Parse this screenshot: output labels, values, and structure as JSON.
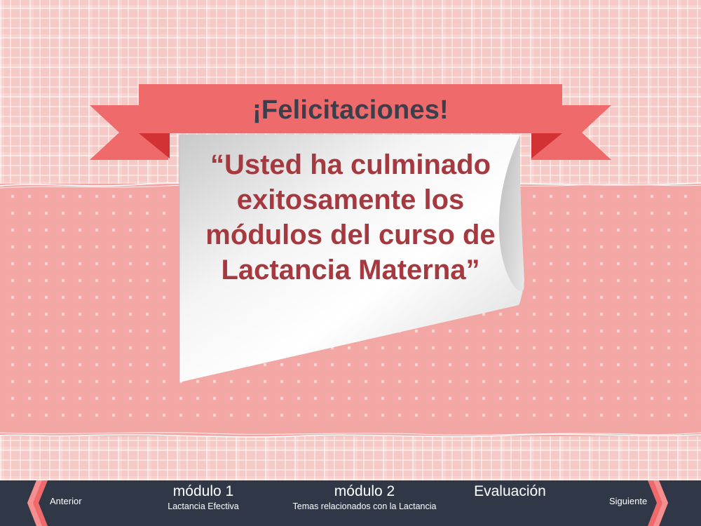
{
  "banner": {
    "title": "¡Felicitaciones!",
    "message": "“Usted ha culminado exitosamente los módulos del curso de Lactancia Materna”"
  },
  "nav": {
    "prev_label": "Anterior",
    "next_label": "Siguiente",
    "items": [
      {
        "title": "módulo 1",
        "subtitle": "Lactancia Efectiva"
      },
      {
        "title": "módulo 2",
        "subtitle": "Temas relacionados con la Lactancia"
      },
      {
        "title": "Evaluación",
        "subtitle": ""
      }
    ]
  },
  "colors": {
    "ribbon": "#ee6a6b",
    "ribbon_dark": "#d33235",
    "message_text": "#a6383f",
    "title_text": "#3b3f4c",
    "navbar": "#303848",
    "arrow": "#f06a6b"
  },
  "icons": {
    "prev": "chevron-left-icon",
    "next": "chevron-right-icon"
  }
}
